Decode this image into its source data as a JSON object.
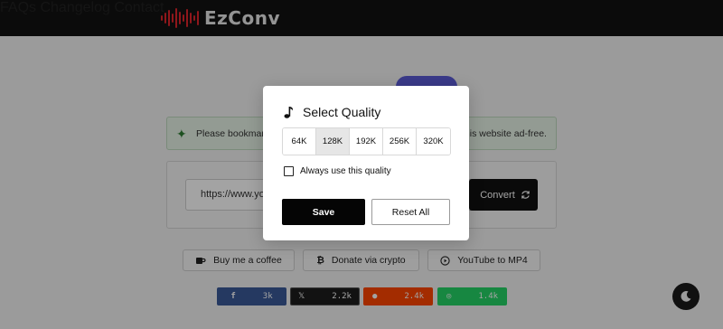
{
  "header": {
    "logo_text": "EzConv",
    "nav": [
      {
        "label": "FAQs"
      },
      {
        "label": "Changelog"
      },
      {
        "label": "Contact"
      }
    ]
  },
  "main": {
    "title_partial": "",
    "notice": {
      "text_left": "Please bookmark",
      "text_right": "this website ad-free.",
      "icon": "sparkle-icon"
    },
    "url_input": {
      "value": "https://www.you"
    },
    "convert_button": {
      "label": "Convert",
      "icon": "refresh-icon"
    },
    "links": [
      {
        "label": "Buy me a coffee",
        "icon": "coffee-icon"
      },
      {
        "label": "Donate via crypto",
        "icon": "bitcoin-icon"
      },
      {
        "label": "YouTube to MP4",
        "icon": "play-circle-icon"
      }
    ],
    "share": [
      {
        "network": "facebook",
        "icon_char": "f",
        "count": "3k",
        "color": "#3b5998"
      },
      {
        "network": "x",
        "icon_char": "𝕏",
        "count": "2.2k",
        "color": "#1d1d1d"
      },
      {
        "network": "reddit",
        "icon_char": "●",
        "count": "2.4k",
        "color": "#ff4500"
      },
      {
        "network": "whatsapp",
        "icon_char": "◎",
        "count": "1.4k",
        "color": "#25d366"
      }
    ]
  },
  "modal": {
    "title": "Select Quality",
    "title_icon": "music-note-icon",
    "options": [
      "64K",
      "128K",
      "192K",
      "256K",
      "320K"
    ],
    "selected": "128K",
    "checkbox_label": "Always use this quality",
    "checkbox_checked": false,
    "save_label": "Save",
    "reset_label": "Reset All"
  },
  "colors": {
    "header_bg": "#121212",
    "logo_red": "#e0242b",
    "accent_purple": "#5b5bd6"
  }
}
